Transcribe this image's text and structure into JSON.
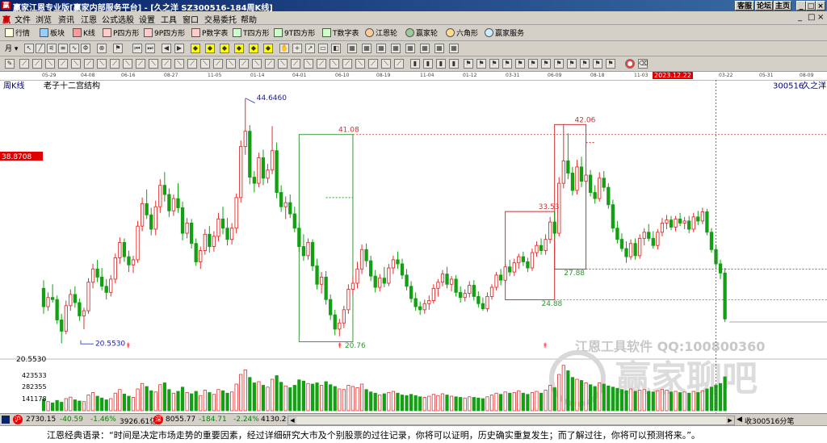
{
  "window": {
    "title": "赢家江恩专业版[赢家内部服务平台] - [久之洋 SZ300516-184周K线]",
    "buttons": [
      "客服",
      "论坛",
      "主页"
    ],
    "min": "_",
    "restore": "□",
    "close": "×"
  },
  "menu": [
    "文件",
    "浏览",
    "资讯",
    "江恩",
    "公式选股",
    "设置",
    "工具",
    "窗口",
    "交易委托",
    "帮助"
  ],
  "toolbar1": [
    {
      "label": "行情",
      "icon": "quote-icon"
    },
    {
      "label": "板块",
      "icon": "sector-icon"
    },
    {
      "label": "K线",
      "icon": "kline-icon"
    },
    {
      "label": "P四方形",
      "icon": "p-square-icon"
    },
    {
      "label": "9P四方形",
      "icon": "9p-square-icon"
    },
    {
      "label": "P数字表",
      "icon": "p-number-table-icon"
    },
    {
      "label": "T四方形",
      "icon": "t-square-icon"
    },
    {
      "label": "9T四方形",
      "icon": "9t-square-icon"
    },
    {
      "label": "T数字表",
      "icon": "t-number-table-icon"
    },
    {
      "label": "江恩轮",
      "icon": "gann-wheel-icon"
    },
    {
      "label": "赢家轮",
      "icon": "winner-wheel-icon"
    },
    {
      "label": "六角形",
      "icon": "hexagon-icon"
    },
    {
      "label": "赢家服务",
      "icon": "service-icon"
    }
  ],
  "period_select": "月",
  "time_axis": {
    "labels": [
      "05-29",
      "04-08",
      "06-16",
      "08-27",
      "11-05",
      "01-14",
      "04-01",
      "06-10",
      "08-19",
      "11-04",
      "01-12",
      "03-31",
      "06-09",
      "08-18",
      "11-03",
      "2023.12.22",
      "03-22",
      "05-31",
      "08-09"
    ],
    "highlight": "2023.12.22"
  },
  "chart_header": {
    "period": "周K线",
    "title": "老子十二宫结构",
    "code": "300516",
    "name": "久之洋"
  },
  "price_axis": {
    "current_price_label": "38.8708",
    "min_label": "20.5530",
    "volume_labels": [
      "423533",
      "282355",
      "141178"
    ]
  },
  "watermark": {
    "line1": "江恩工具软件  QQ:100800360",
    "line2": "赢家聊吧"
  },
  "chart_data": {
    "type": "candlestick",
    "price_range": [
      19.3,
      46.2
    ],
    "high_mark": 44.646,
    "low_mark": 20.553,
    "annotations": [
      {
        "text": "44.6460",
        "price": 44.646
      },
      {
        "text": "20.5530",
        "price": 20.553
      },
      {
        "text": "41.08",
        "price": 41.08
      },
      {
        "text": "20.76",
        "price": 20.76
      },
      {
        "text": "42.06",
        "price": 42.06
      },
      {
        "text": "33.53",
        "price": 33.53
      },
      {
        "text": "27.88",
        "price": 27.88
      },
      {
        "text": "24.88",
        "price": 24.88
      }
    ],
    "boxes": [
      {
        "color": "#3a9a3a",
        "from_bar": 57,
        "to_bar": 69,
        "top": 41.08,
        "bottom": 20.76
      },
      {
        "color": "#d03030",
        "from_bar": 103,
        "to_bar": 114,
        "top": 33.53,
        "bottom": 24.88
      },
      {
        "color": "#d03030",
        "from_bar": 114,
        "to_bar": 121,
        "top": 42.06,
        "bottom": 27.88
      }
    ],
    "ref_lines": [
      41.08,
      27.88,
      24.88
    ],
    "cursor_bar": 150,
    "candles": [
      [
        26.0,
        26.8,
        23.5,
        24.2
      ],
      [
        24.2,
        25.6,
        23.8,
        25.1
      ],
      [
        25.1,
        26.4,
        24.6,
        24.9
      ],
      [
        24.9,
        25.3,
        22.5,
        22.9
      ],
      [
        22.9,
        23.5,
        20.6,
        21.8
      ],
      [
        21.8,
        24.8,
        21.5,
        24.3
      ],
      [
        24.3,
        25.9,
        23.8,
        25.4
      ],
      [
        25.4,
        26.2,
        24.1,
        24.6
      ],
      [
        24.6,
        25.0,
        22.8,
        23.3
      ],
      [
        23.3,
        24.1,
        22.0,
        23.8
      ],
      [
        23.8,
        27.0,
        23.5,
        26.6
      ],
      [
        26.6,
        28.4,
        26.0,
        27.9
      ],
      [
        27.9,
        28.8,
        26.6,
        27.1
      ],
      [
        27.1,
        28.0,
        25.8,
        26.2
      ],
      [
        26.2,
        26.9,
        24.9,
        25.6
      ],
      [
        25.6,
        27.3,
        25.2,
        26.9
      ],
      [
        26.9,
        29.4,
        26.5,
        29.0
      ],
      [
        29.0,
        31.0,
        28.4,
        30.5
      ],
      [
        30.5,
        30.9,
        28.6,
        29.1
      ],
      [
        29.1,
        29.7,
        27.6,
        28.3
      ],
      [
        28.3,
        29.2,
        27.5,
        28.8
      ],
      [
        28.8,
        32.6,
        28.5,
        32.1
      ],
      [
        32.1,
        34.9,
        31.6,
        34.3
      ],
      [
        34.3,
        35.7,
        32.8,
        33.2
      ],
      [
        33.2,
        33.9,
        31.2,
        31.8
      ],
      [
        31.8,
        34.6,
        31.2,
        34.0
      ],
      [
        34.0,
        36.7,
        33.4,
        36.1
      ],
      [
        36.1,
        37.4,
        34.5,
        35.2
      ],
      [
        35.2,
        35.8,
        33.0,
        33.6
      ],
      [
        33.6,
        35.2,
        33.1,
        34.8
      ],
      [
        34.8,
        36.3,
        33.4,
        33.9
      ],
      [
        33.9,
        34.5,
        30.7,
        31.4
      ],
      [
        31.4,
        32.9,
        30.9,
        32.4
      ],
      [
        32.4,
        32.8,
        29.9,
        30.4
      ],
      [
        30.4,
        30.9,
        28.2,
        28.6
      ],
      [
        28.6,
        30.1,
        27.9,
        29.7
      ],
      [
        29.7,
        31.8,
        29.3,
        31.3
      ],
      [
        31.3,
        32.1,
        29.5,
        30.1
      ],
      [
        30.1,
        31.6,
        29.6,
        31.1
      ],
      [
        31.1,
        33.4,
        30.6,
        32.8
      ],
      [
        32.8,
        34.0,
        31.3,
        31.9
      ],
      [
        31.9,
        32.9,
        30.2,
        30.8
      ],
      [
        30.8,
        32.4,
        30.3,
        31.9
      ],
      [
        31.9,
        35.3,
        31.4,
        34.9
      ],
      [
        34.9,
        40.5,
        34.4,
        39.9
      ],
      [
        39.9,
        44.6,
        39.1,
        41.4
      ],
      [
        41.4,
        42.0,
        36.2,
        36.9
      ],
      [
        36.9,
        37.5,
        35.4,
        36.3
      ],
      [
        36.3,
        39.3,
        35.9,
        38.8
      ],
      [
        38.8,
        39.6,
        36.1,
        36.8
      ],
      [
        36.8,
        38.2,
        36.3,
        37.6
      ],
      [
        37.6,
        41.9,
        37.2,
        39.5
      ],
      [
        39.5,
        40.3,
        34.8,
        35.4
      ],
      [
        35.4,
        36.1,
        33.5,
        34.0
      ],
      [
        34.0,
        35.0,
        32.8,
        34.4
      ],
      [
        34.4,
        35.2,
        32.9,
        33.3
      ],
      [
        33.3,
        34.0,
        31.5,
        31.9
      ],
      [
        31.9,
        32.4,
        29.6,
        30.1
      ],
      [
        30.1,
        31.3,
        28.7,
        29.2
      ],
      [
        29.2,
        30.9,
        28.8,
        30.5
      ],
      [
        30.5,
        30.8,
        27.7,
        28.2
      ],
      [
        28.2,
        28.9,
        25.9,
        26.4
      ],
      [
        26.4,
        27.6,
        25.5,
        27.1
      ],
      [
        27.1,
        27.7,
        24.4,
        24.9
      ],
      [
        24.9,
        25.4,
        22.9,
        23.4
      ],
      [
        23.4,
        23.9,
        21.4,
        22.0
      ],
      [
        22.0,
        23.0,
        21.3,
        22.6
      ],
      [
        22.6,
        24.3,
        22.1,
        23.9
      ],
      [
        23.9,
        26.4,
        23.5,
        25.9
      ],
      [
        25.9,
        27.2,
        25.3,
        26.5
      ],
      [
        26.5,
        28.6,
        26.0,
        27.9
      ],
      [
        27.9,
        30.3,
        27.4,
        29.8
      ],
      [
        29.8,
        30.4,
        28.1,
        28.7
      ],
      [
        28.7,
        29.2,
        26.7,
        27.2
      ],
      [
        27.2,
        27.8,
        25.6,
        26.1
      ],
      [
        26.1,
        27.4,
        25.7,
        27.0
      ],
      [
        27.0,
        28.1,
        26.1,
        26.5
      ],
      [
        26.5,
        28.4,
        26.2,
        28.0
      ],
      [
        28.0,
        29.2,
        27.4,
        28.8
      ],
      [
        28.8,
        29.6,
        27.9,
        28.4
      ],
      [
        28.4,
        28.9,
        26.9,
        27.3
      ],
      [
        27.3,
        27.9,
        25.8,
        26.2
      ],
      [
        26.2,
        26.7,
        24.6,
        25.0
      ],
      [
        25.0,
        25.6,
        23.8,
        24.2
      ],
      [
        24.2,
        24.7,
        23.4,
        23.9
      ],
      [
        23.9,
        24.9,
        23.5,
        24.5
      ],
      [
        24.5,
        25.3,
        23.9,
        24.8
      ],
      [
        24.8,
        26.4,
        24.5,
        26.0
      ],
      [
        26.0,
        26.9,
        25.2,
        26.6
      ],
      [
        26.6,
        27.8,
        26.2,
        27.4
      ],
      [
        27.4,
        28.1,
        26.0,
        26.4
      ],
      [
        26.4,
        27.2,
        25.7,
        26.9
      ],
      [
        26.9,
        27.3,
        25.2,
        25.6
      ],
      [
        25.6,
        26.2,
        24.6,
        25.1
      ],
      [
        25.1,
        25.9,
        24.7,
        25.5
      ],
      [
        25.5,
        26.7,
        25.1,
        26.3
      ],
      [
        26.3,
        26.8,
        24.8,
        25.2
      ],
      [
        25.2,
        25.7,
        24.1,
        24.5
      ],
      [
        24.5,
        25.1,
        23.8,
        24.0
      ],
      [
        24.0,
        25.6,
        23.7,
        25.2
      ],
      [
        25.2,
        26.4,
        24.9,
        26.1
      ],
      [
        26.1,
        27.6,
        25.8,
        27.3
      ],
      [
        27.3,
        27.9,
        26.3,
        26.8
      ],
      [
        26.8,
        28.4,
        26.5,
        28.1
      ],
      [
        28.1,
        28.8,
        27.2,
        27.6
      ],
      [
        27.6,
        28.9,
        27.2,
        28.5
      ],
      [
        28.5,
        29.4,
        27.9,
        29.1
      ],
      [
        29.1,
        29.6,
        28.2,
        28.6
      ],
      [
        28.6,
        29.0,
        27.6,
        28.0
      ],
      [
        28.0,
        29.9,
        27.7,
        29.5
      ],
      [
        29.5,
        30.6,
        29.1,
        30.2
      ],
      [
        30.2,
        30.9,
        29.3,
        29.7
      ],
      [
        29.7,
        31.3,
        29.3,
        30.8
      ],
      [
        30.8,
        33.0,
        30.4,
        32.5
      ],
      [
        32.5,
        33.6,
        30.9,
        31.4
      ],
      [
        31.4,
        36.9,
        31.1,
        36.3
      ],
      [
        36.3,
        42.1,
        35.8,
        38.5
      ],
      [
        38.5,
        41.2,
        36.7,
        37.3
      ],
      [
        37.3,
        37.9,
        35.1,
        35.6
      ],
      [
        35.6,
        38.6,
        35.2,
        37.9
      ],
      [
        37.9,
        38.9,
        35.9,
        36.5
      ],
      [
        36.5,
        37.8,
        35.6,
        37.1
      ],
      [
        37.1,
        37.6,
        35.0,
        35.4
      ],
      [
        35.4,
        36.1,
        34.3,
        34.8
      ],
      [
        34.8,
        37.4,
        34.5,
        36.8
      ],
      [
        36.8,
        37.5,
        35.5,
        35.9
      ],
      [
        35.9,
        36.3,
        33.8,
        34.2
      ],
      [
        34.2,
        34.7,
        31.5,
        31.9
      ],
      [
        31.9,
        32.6,
        30.4,
        30.8
      ],
      [
        30.8,
        31.4,
        29.6,
        29.9
      ],
      [
        29.9,
        30.6,
        28.5,
        29.1
      ],
      [
        29.1,
        30.8,
        28.8,
        30.4
      ],
      [
        30.4,
        30.9,
        28.8,
        29.2
      ],
      [
        29.2,
        31.3,
        28.9,
        30.9
      ],
      [
        30.9,
        31.9,
        30.2,
        31.5
      ],
      [
        31.5,
        32.3,
        30.6,
        30.9
      ],
      [
        30.9,
        31.6,
        29.9,
        30.2
      ],
      [
        30.2,
        31.8,
        29.8,
        31.5
      ],
      [
        31.5,
        32.9,
        31.1,
        32.4
      ],
      [
        32.4,
        33.2,
        31.8,
        32.7
      ],
      [
        32.7,
        33.1,
        31.7,
        32.0
      ],
      [
        32.0,
        33.1,
        31.6,
        32.8
      ],
      [
        32.8,
        33.4,
        32.1,
        32.4
      ],
      [
        32.4,
        33.0,
        31.8,
        32.6
      ],
      [
        32.6,
        33.1,
        31.4,
        31.8
      ],
      [
        31.8,
        33.4,
        31.5,
        33.0
      ],
      [
        33.0,
        33.6,
        32.2,
        32.6
      ],
      [
        32.6,
        33.9,
        32.3,
        33.5
      ],
      [
        33.5,
        33.8,
        31.2,
        31.5
      ],
      [
        31.5,
        31.9,
        29.5,
        29.8
      ],
      [
        29.8,
        30.3,
        28.1,
        28.4
      ],
      [
        28.4,
        28.8,
        26.9,
        27.5
      ],
      [
        27.5,
        28.0,
        22.7,
        23.0
      ]
    ],
    "volumes": [
      38,
      30,
      26,
      34,
      28,
      40,
      45,
      36,
      32,
      30,
      52,
      60,
      48,
      42,
      36,
      40,
      58,
      70,
      55,
      48,
      44,
      72,
      90,
      80,
      66,
      62,
      86,
      92,
      70,
      58,
      64,
      78,
      60,
      56,
      64,
      50,
      68,
      60,
      54,
      70,
      66,
      58,
      62,
      88,
      120,
      135,
      110,
      92,
      96,
      84,
      78,
      104,
      116,
      94,
      82,
      76,
      84,
      102,
      98,
      90,
      88,
      92,
      84,
      96,
      86,
      80,
      72,
      70,
      84,
      80,
      76,
      88,
      70,
      62,
      58,
      52,
      56,
      60,
      64,
      58,
      52,
      50,
      54,
      50,
      46,
      44,
      48,
      54,
      50,
      56,
      52,
      48,
      46,
      44,
      42,
      46,
      44,
      42,
      40,
      46,
      52,
      58,
      54,
      62,
      58,
      60,
      66,
      58,
      54,
      60,
      64,
      58,
      68,
      84,
      76,
      120,
      150,
      132,
      110,
      104,
      100,
      92,
      86,
      80,
      92,
      88,
      82,
      78,
      74,
      70,
      66,
      72,
      64,
      68,
      70,
      64,
      62,
      66,
      70,
      68,
      62,
      64,
      60,
      62,
      58,
      64,
      60,
      66,
      72,
      78,
      84,
      90,
      112
    ]
  },
  "bottom_bar": {
    "index1_value": "2730.15",
    "index1_change": "-40.59",
    "index1_pct": "-1.46%",
    "index1_amount": "3926.61亿",
    "index2_value": "8055.77",
    "index2_change": "-184.71",
    "index2_pct": "-2.24%",
    "index2_amount": "4130.2",
    "right_label": "收300516分笔"
  },
  "status_quote": "江恩经典语录：“时间是决定市场走势的重要因素，经过详细研究大市及个别股票的过往记录，你将可以证明，历史确实重复发生；而了解过往，你将可以预测将来。”。"
}
